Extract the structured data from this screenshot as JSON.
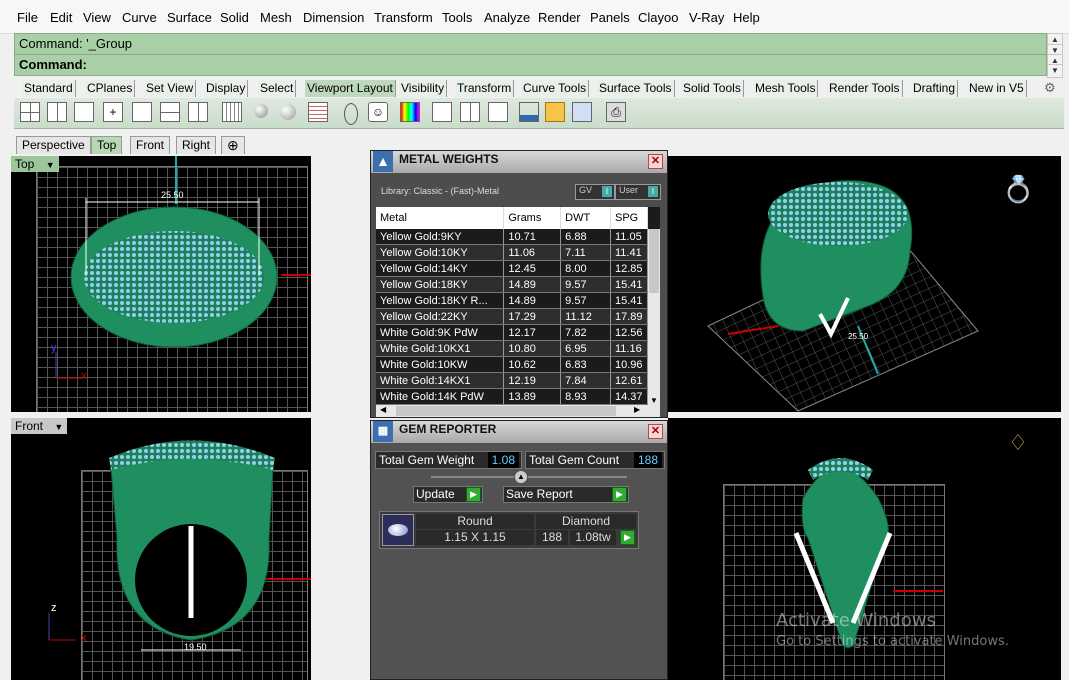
{
  "menu": [
    "File",
    "Edit",
    "View",
    "Curve",
    "Surface",
    "Solid",
    "Mesh",
    "Dimension",
    "Transform",
    "Tools",
    "Analyze",
    "Render",
    "Panels",
    "Clayoo",
    "V-Ray",
    "Help"
  ],
  "command": {
    "history": "Command: '_Group",
    "prompt": "Command:"
  },
  "toolbar_tabs": [
    "Standard",
    "CPlanes",
    "Set View",
    "Display",
    "Select",
    "Viewport Layout",
    "Visibility",
    "Transform",
    "Curve Tools",
    "Surface Tools",
    "Solid Tools",
    "Mesh Tools",
    "Render Tools",
    "Drafting",
    "New in V5"
  ],
  "toolbar_active_tab": "Viewport Layout",
  "viewport_tabs": [
    "Perspective",
    "Top",
    "Front",
    "Right"
  ],
  "viewport_active_tab": "Top",
  "viewports": {
    "top": {
      "label": "Top",
      "dimension": "25.50",
      "axis_y": "y",
      "axis_x": "x"
    },
    "front": {
      "label": "Front",
      "dimension": "19.50",
      "axis_z": "z",
      "axis_x": "x"
    },
    "perspective": {
      "dimension": "25.50"
    }
  },
  "metal_weights": {
    "title": "METAL WEIGHTS",
    "library": "Library: Classic - (Fast)-Metal",
    "gv_label": "GV",
    "user_label": "User",
    "columns": [
      "Metal",
      "Grams",
      "DWT",
      "SPG"
    ],
    "rows": [
      [
        "Yellow Gold:9KY",
        "10.71",
        "6.88",
        "11.05"
      ],
      [
        "Yellow Gold:10KY",
        "11.06",
        "7.11",
        "11.41"
      ],
      [
        "Yellow Gold:14KY",
        "12.45",
        "8.00",
        "12.85"
      ],
      [
        "Yellow Gold:18KY",
        "14.89",
        "9.57",
        "15.41"
      ],
      [
        "Yellow Gold:18KY R...",
        "14.89",
        "9.57",
        "15.41"
      ],
      [
        "Yellow Gold:22KY",
        "17.29",
        "11.12",
        "17.89"
      ],
      [
        "White Gold:9K PdW",
        "12.17",
        "7.82",
        "12.56"
      ],
      [
        "White Gold:10KX1",
        "10.80",
        "6.95",
        "11.16"
      ],
      [
        "White Gold:10KW",
        "10.62",
        "6.83",
        "10.96"
      ],
      [
        "White Gold:14KX1",
        "12.19",
        "7.84",
        "12.61"
      ],
      [
        "White Gold:14K PdW",
        "13.89",
        "8.93",
        "14.37"
      ]
    ]
  },
  "gem_reporter": {
    "title": "GEM REPORTER",
    "total_weight_label": "Total Gem Weight",
    "total_weight_value": "1.08",
    "total_count_label": "Total Gem Count",
    "total_count_value": "188",
    "update_label": "Update",
    "save_report_label": "Save Report",
    "gem_shape": "Round",
    "gem_type": "Diamond",
    "gem_size": "1.15 X 1.15",
    "gem_count": "188",
    "gem_weight": "1.08tw"
  },
  "watermark": {
    "line1": "Activate Windows",
    "line2": "Go to Settings to activate Windows."
  },
  "colors": {
    "ring_green": "#1f8f5f",
    "gem_blue": "#7fc4e8",
    "command_green": "#a9cfa7",
    "viewport_bg": "#000000"
  }
}
